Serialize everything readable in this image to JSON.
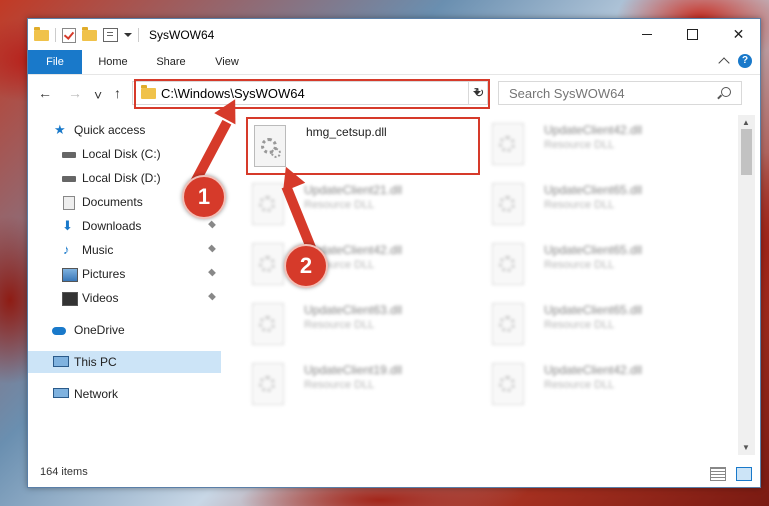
{
  "window": {
    "title": "SysWOW64"
  },
  "ribbon": {
    "tabs": [
      "File",
      "Home",
      "Share",
      "View"
    ],
    "help": "?"
  },
  "nav": {
    "back": "←",
    "forward": "→",
    "recent": "˅",
    "up": "↑",
    "address": "C:\\Windows\\SysWOW64",
    "refresh": "↻",
    "search_placeholder": "Search SysWOW64"
  },
  "sidebar": {
    "items": [
      {
        "label": "Quick access",
        "icon": "star-icon"
      },
      {
        "label": "Local Disk (C:)",
        "icon": "drive-icon",
        "pinned": true
      },
      {
        "label": "Local Disk (D:)",
        "icon": "drive-icon"
      },
      {
        "label": "Documents",
        "icon": "document-icon",
        "pinned": true
      },
      {
        "label": "Downloads",
        "icon": "download-icon",
        "pinned": true
      },
      {
        "label": "Music",
        "icon": "music-icon",
        "pinned": true
      },
      {
        "label": "Pictures",
        "icon": "pictures-icon",
        "pinned": true
      },
      {
        "label": "Videos",
        "icon": "videos-icon",
        "pinned": true
      },
      {
        "label": "OneDrive",
        "icon": "onedrive-icon"
      },
      {
        "label": "This PC",
        "icon": "this-pc-icon",
        "selected": true
      },
      {
        "label": "Network",
        "icon": "network-icon"
      }
    ]
  },
  "files": [
    {
      "name": "hmg_cetsup.dll",
      "type": ""
    },
    {
      "name": "UpdateClient42.dll",
      "type": "Resource DLL"
    },
    {
      "name": "UpdateClient21.dll",
      "type": "Resource DLL"
    },
    {
      "name": "UpdateClient65.dll",
      "type": "Resource DLL"
    },
    {
      "name": "UpdateClient42.dll",
      "type": "Resource DLL"
    },
    {
      "name": "UpdateClient65.dll",
      "type": "Resource DLL"
    },
    {
      "name": "UpdateClient63.dll",
      "type": "Resource DLL"
    },
    {
      "name": "UpdateClient65.dll",
      "type": "Resource DLL"
    },
    {
      "name": "UpdateClient19.dll",
      "type": "Resource DLL"
    },
    {
      "name": "UpdateClient42.dll",
      "type": "Resource DLL"
    }
  ],
  "status": {
    "item_count": "164 items"
  },
  "callouts": [
    "1",
    "2"
  ],
  "colors": {
    "accent": "#1979ca",
    "highlight": "#d63a2a"
  }
}
